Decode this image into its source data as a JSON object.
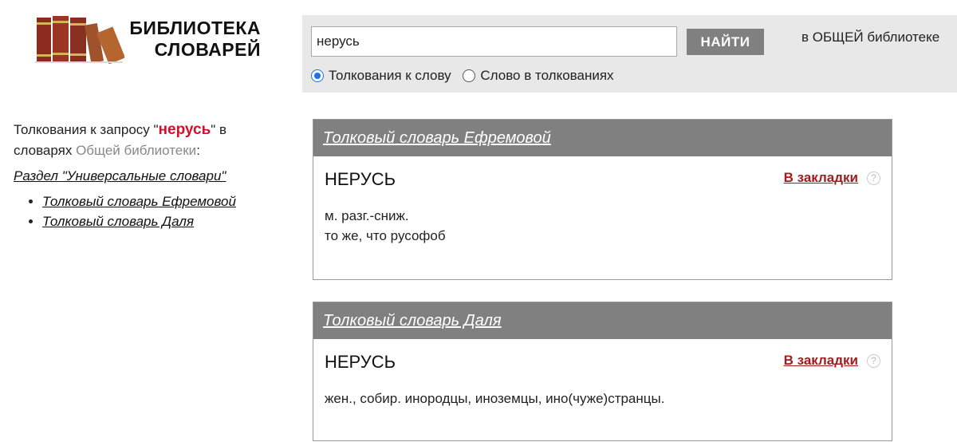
{
  "logo": {
    "line1": "БИБЛИОТЕКА",
    "line2": "СЛОВАРЕЙ",
    "icon": "books-icon",
    "colors": {
      "book_red": "#8b2c1e",
      "book_brown": "#a0522d",
      "gold": "#d8b25a"
    }
  },
  "search": {
    "value": "нерусь",
    "button_label": "НАЙТИ",
    "scope": "в ОБЩЕЙ библиотеке",
    "options": [
      {
        "label": "Толкования к слову",
        "checked": true
      },
      {
        "label": "Слово в толкованиях",
        "checked": false
      }
    ]
  },
  "sidebar": {
    "prefix": "Толкования к запросу \"",
    "query": "нерусь",
    "middle": "\" в словарях ",
    "library_link": "Общей библиотеки",
    "suffix": ":",
    "section_link": "Раздел \"Универсальные словари\"",
    "dictionaries": [
      "Толковый словарь Ефремовой",
      "Толковый словарь Даля"
    ]
  },
  "results": [
    {
      "dictionary": "Толковый словарь Ефремовой",
      "headword": "НЕРУСЬ",
      "bookmark": "В закладки",
      "help": "?",
      "definition_lines": [
        "м. разг.-сниж.",
        "то же, что русофоб"
      ]
    },
    {
      "dictionary": "Толковый словарь Даля",
      "headword": "НЕРУСЬ",
      "bookmark": "В закладки",
      "help": "?",
      "definition_lines": [
        "жен., собир. инородцы, иноземцы, ино(чуже)странцы."
      ]
    }
  ],
  "colors": {
    "panel_bg": "#e8e8e8",
    "header_bg": "#808080",
    "query_red": "#d2102a",
    "bookmark_red": "#a21d1d",
    "radio_blue": "#1a73e8"
  }
}
